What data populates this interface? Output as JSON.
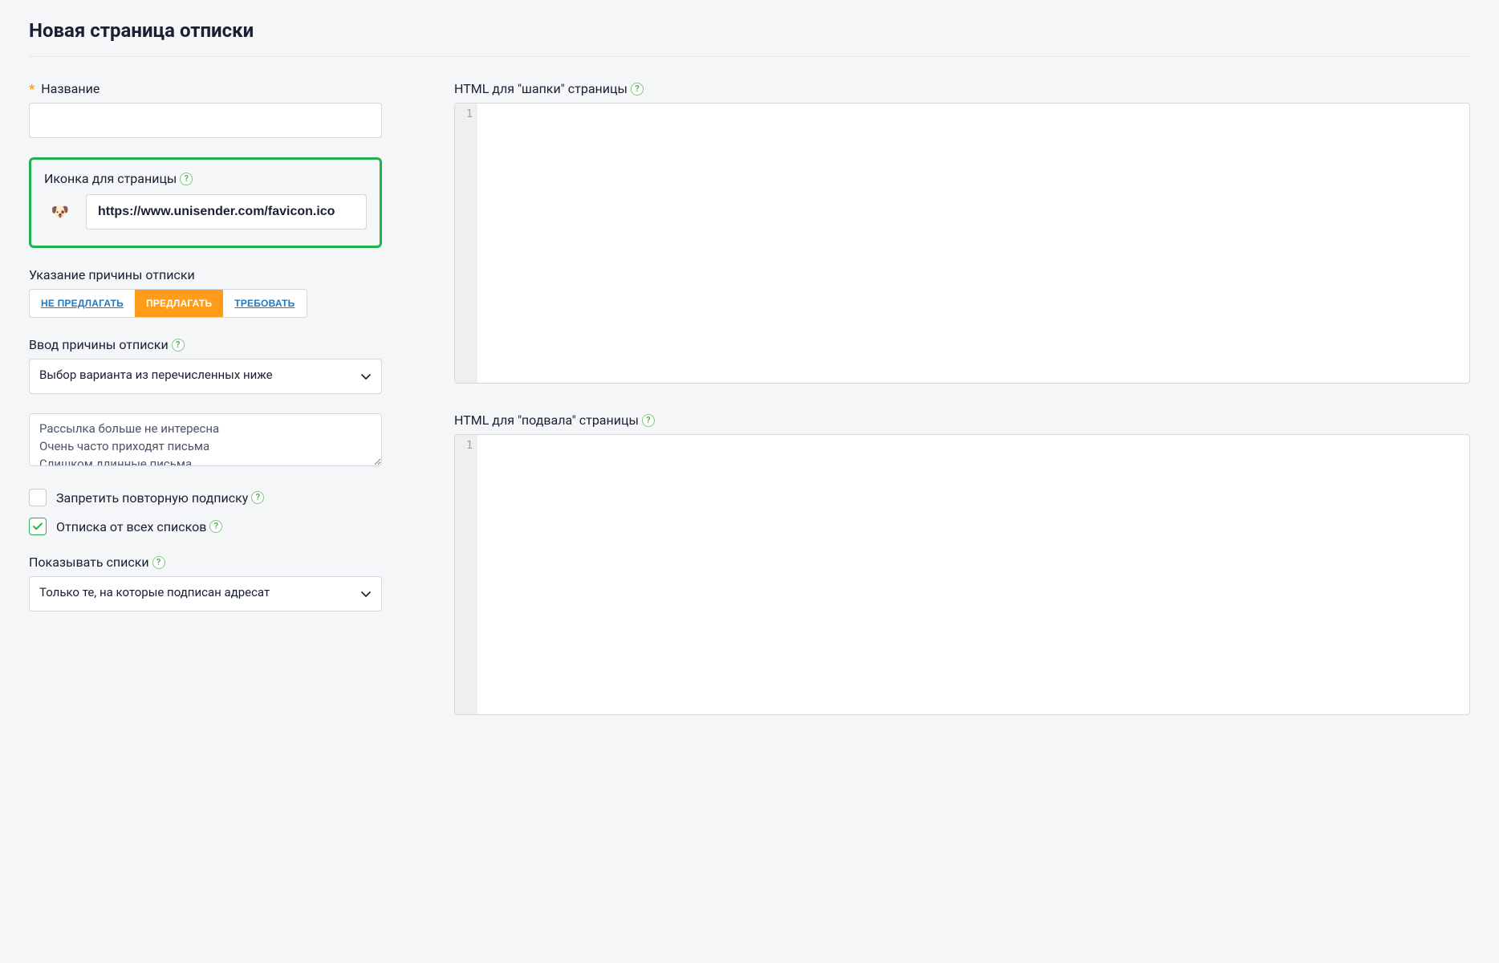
{
  "page": {
    "title": "Новая страница отписки"
  },
  "left": {
    "name": {
      "label": "Название",
      "required": true,
      "value": ""
    },
    "favicon": {
      "label": "Иконка для страницы",
      "emoji": "🐶",
      "value": "https://www.unisender.com/favicon.ico"
    },
    "reason_mode": {
      "label": "Указание причины отписки",
      "options": {
        "none": "НЕ ПРЕДЛАГАТЬ",
        "suggest": "ПРЕДЛАГАТЬ",
        "require": "ТРЕБОВАТЬ"
      },
      "active": "suggest"
    },
    "reason_input": {
      "label": "Ввод причины отписки",
      "selected": "Выбор варианта из перечисленных ниже"
    },
    "reason_presets": {
      "text": "Рассылка больше не интересна\nОчень часто приходят письма\nСлишком длинные письма"
    },
    "checkboxes": {
      "forbid_resubscribe": {
        "label": "Запретить повторную подписку",
        "checked": false
      },
      "unsub_all": {
        "label": "Отписка от всех списков",
        "checked": true
      }
    },
    "show_lists": {
      "label": "Показывать списки",
      "selected": "Только те, на которые подписан адресат"
    }
  },
  "right": {
    "header_html": {
      "label": "HTML для \"шапки\" страницы",
      "line1": "1"
    },
    "footer_html": {
      "label": "HTML для \"подвала\" страницы",
      "line1": "1"
    }
  },
  "icons": {
    "help": "?"
  }
}
